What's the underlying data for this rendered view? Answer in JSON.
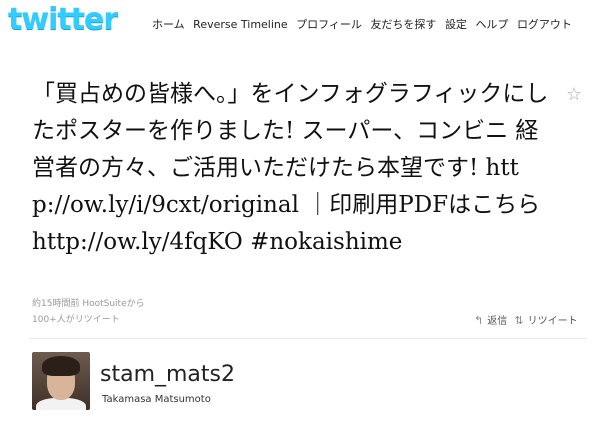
{
  "header": {
    "logo": "twitter",
    "nav": [
      "ホーム",
      "Reverse Timeline",
      "プロフィール",
      "友だちを探す",
      "設定",
      "ヘルプ",
      "ログアウト"
    ]
  },
  "tweet": {
    "text": "「買占めの皆様へ。」をインフォグラフィックにしたポスターを作りました! スーパー、コンビニ 経営者の方々、ご活用いただけたら本望です! http://ow.ly/i/9cxt/original ｜印刷用PDFはこちらhttp://ow.ly/4fqKO #nokaishime",
    "timestamp": "約15時間前",
    "source": "HootSuite",
    "source_suffix": "から",
    "retweet_count": "100+人がリツイート",
    "reply_label": "返信",
    "retweet_label": "リツイート"
  },
  "user": {
    "screen_name": "stam_mats2",
    "full_name": "Takamasa Matsumoto"
  },
  "icons": {
    "favorite": "star-icon",
    "reply": "reply-icon",
    "retweet": "retweet-icon"
  },
  "colors": {
    "logo": "#33ccff",
    "background": "#ffffff"
  }
}
